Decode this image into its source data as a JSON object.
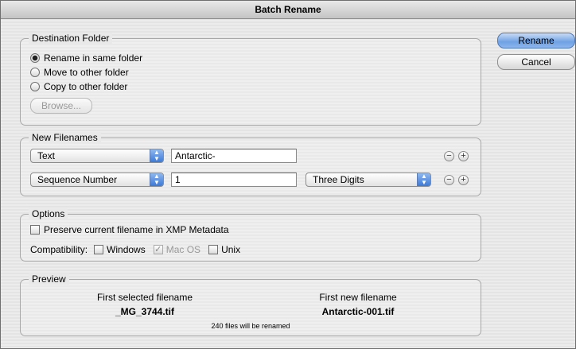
{
  "window": {
    "title": "Batch Rename"
  },
  "buttons": {
    "rename": "Rename",
    "cancel": "Cancel"
  },
  "destination": {
    "title": "Destination Folder",
    "options": [
      {
        "label": "Rename in same folder",
        "selected": true
      },
      {
        "label": "Move to other folder",
        "selected": false
      },
      {
        "label": "Copy to other folder",
        "selected": false
      }
    ],
    "browse_label": "Browse..."
  },
  "new_filenames": {
    "title": "New Filenames",
    "rows": [
      {
        "type": "Text",
        "value": "Antarctic-",
        "extra": ""
      },
      {
        "type": "Sequence Number",
        "value": "1",
        "extra": "Three Digits"
      }
    ],
    "minus_symbol": "−",
    "plus_symbol": "+"
  },
  "options": {
    "title": "Options",
    "preserve_label": "Preserve current filename in XMP Metadata",
    "preserve_checked": false,
    "compat_label": "Compatibility:",
    "compat": [
      {
        "label": "Windows",
        "checked": false,
        "disabled": false
      },
      {
        "label": "Mac OS",
        "checked": true,
        "disabled": true
      },
      {
        "label": "Unix",
        "checked": false,
        "disabled": false
      }
    ]
  },
  "preview": {
    "title": "Preview",
    "first_selected_label": "First selected filename",
    "first_selected_value": "_MG_3744.tif",
    "first_new_label": "First new filename",
    "first_new_value": "Antarctic-001.tif",
    "summary": "240 files will be renamed"
  }
}
